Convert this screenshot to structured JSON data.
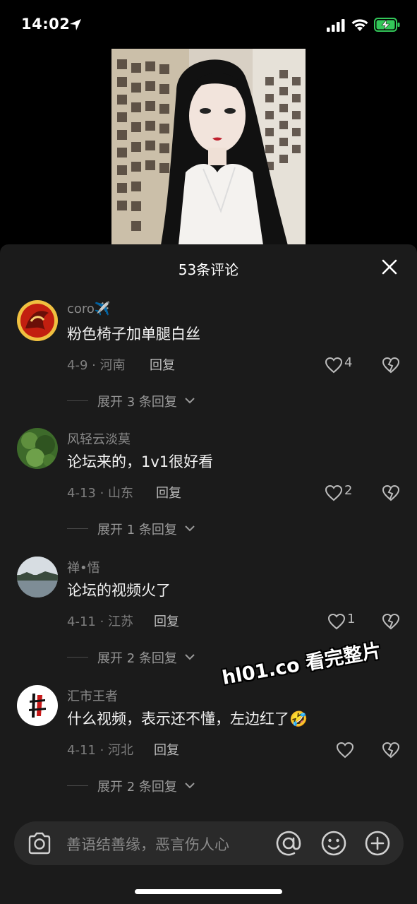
{
  "status_bar": {
    "time": "14:02"
  },
  "sheet": {
    "title": "53条评论"
  },
  "comments": [
    {
      "user": "coro✈️",
      "text": "粉色椅子加单腿白丝",
      "meta": "4-9 · 河南",
      "reply": "回复",
      "likes": "4",
      "expand": "展开 3 条回复"
    },
    {
      "user": "风轻云淡莫",
      "text": "论坛来的，1v1很好看",
      "meta": "4-13 · 山东",
      "reply": "回复",
      "likes": "2",
      "expand": "展开 1 条回复"
    },
    {
      "user": "禅•悟",
      "text": "论坛的视频火了",
      "meta": "4-11 · 江苏",
      "reply": "回复",
      "likes": "1",
      "expand": "展开 2 条回复"
    },
    {
      "user": "汇市王者",
      "text": "什么视频，表示还不懂，左边红了🤣",
      "meta": "4-11 · 河北",
      "reply": "回复",
      "likes": "",
      "expand": "展开 2 条回复"
    }
  ],
  "watermark": "hl01.co 看完整片",
  "input": {
    "placeholder": "善语结善缘，恶言伤人心"
  },
  "colors": {
    "sheet_bg": "#1b1b1b",
    "input_bg": "#2a2a2a",
    "battery": "#33c759"
  },
  "icons": [
    "location-arrow-icon",
    "cellular-signal-icon",
    "wifi-icon",
    "battery-charging-icon",
    "close-icon",
    "heart-icon",
    "broken-heart-icon",
    "chevron-down-icon",
    "camera-icon",
    "at-icon",
    "emoji-icon",
    "plus-icon"
  ]
}
